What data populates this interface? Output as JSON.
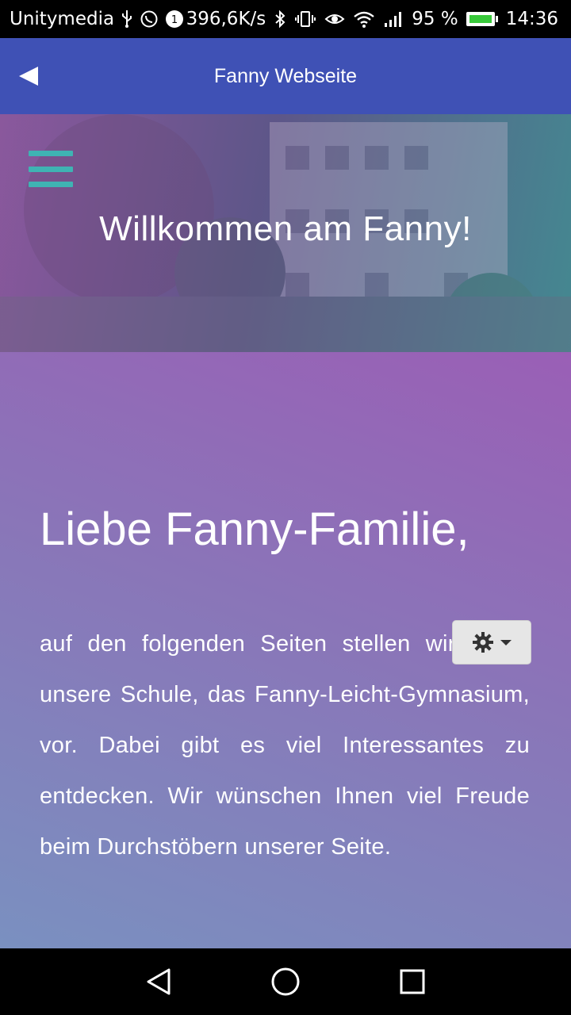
{
  "status_bar": {
    "carrier": "Unitymedia",
    "speed": "396,6K/s",
    "battery_percent": "95 %",
    "time": "14:36",
    "icons": [
      "usb-icon",
      "whatsapp-icon",
      "notification-icon",
      "bluetooth-icon",
      "vibrate-icon",
      "eye-icon",
      "wifi-icon",
      "signal-icon",
      "battery-icon"
    ]
  },
  "app_bar": {
    "title": "Fanny Webseite",
    "color": "#3f51b5"
  },
  "hero": {
    "title": "Willkommen am Fanny!"
  },
  "content": {
    "heading": "Liebe Fanny-Familie,",
    "text": "auf den folgenden Seiten stellen wir Ihnen unsere Schule, das Fanny-Leicht-Gymnasium, vor. Dabei gibt es viel Interessantes zu entdecken. Wir wünschen Ihnen viel Freude beim Durchstöbern unserer Seite."
  },
  "nav_bar": {
    "icons": [
      "back-triangle-icon",
      "home-circle-icon",
      "recents-square-icon"
    ]
  }
}
